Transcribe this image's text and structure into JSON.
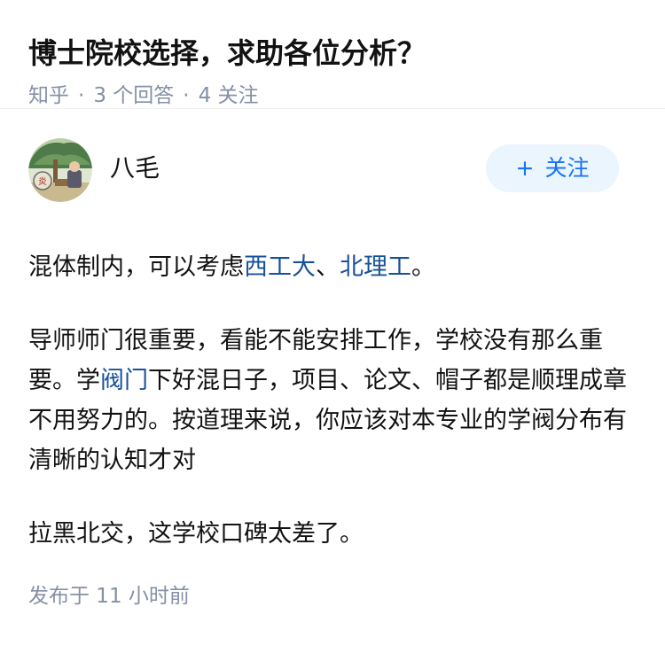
{
  "question": {
    "title": "博士院校选择，求助各位分析？",
    "source": "知乎",
    "answer_count": "3 个回答",
    "follower_count": "4 关注"
  },
  "answer": {
    "author": {
      "name": "八毛",
      "avatar_icon": "avatar-image"
    },
    "follow_button": {
      "icon": "+",
      "label": "关注"
    },
    "paragraphs": {
      "p1": {
        "a": "混体制内，可以考虑",
        "link1": "西工大",
        "b": "、",
        "link2": "北理工",
        "c": "。"
      },
      "p2": {
        "a": "导师师门很重要，看能不能安排工作，学校没有那么重要。学",
        "link1": "阀门",
        "b": "下好混日子，项目、论文、帽子都是顺理成章不用努力的。按道理来说，你应该对本专业的学阀分布有清晰的认知才对"
      },
      "p3": {
        "a": "拉黑北交，这学校口碑太差了。"
      }
    },
    "publish_time": "发布于 11 小时前"
  },
  "colors": {
    "link": "#175199",
    "meta": "#8590a6",
    "follow_bg": "#ebf5fd",
    "follow_text": "#1772f6"
  }
}
